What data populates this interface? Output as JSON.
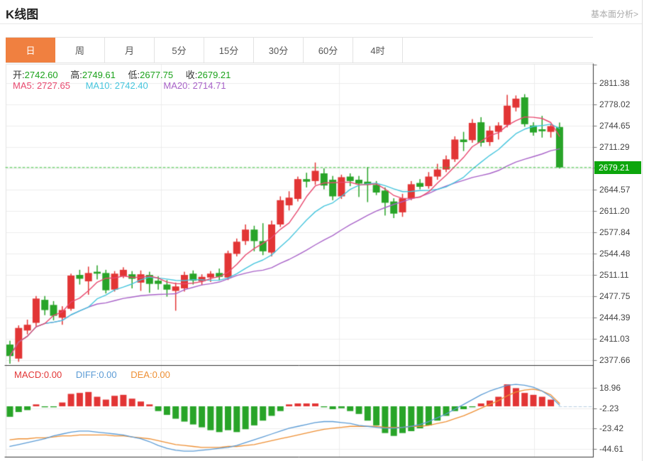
{
  "header": {
    "title": "K线图",
    "link_label": "基本面分析>"
  },
  "tabs": {
    "items": [
      {
        "label": "日",
        "active": true
      },
      {
        "label": "周",
        "active": false
      },
      {
        "label": "月",
        "active": false
      },
      {
        "label": "5分",
        "active": false
      },
      {
        "label": "15分",
        "active": false
      },
      {
        "label": "30分",
        "active": false
      },
      {
        "label": "60分",
        "active": false
      },
      {
        "label": "4时",
        "active": false
      }
    ]
  },
  "legend_ohlc": {
    "open_label": "开:",
    "open_value": "2742.60",
    "high_label": "高:",
    "high_value": "2749.61",
    "low_label": "低:",
    "low_value": "2677.75",
    "close_label": "收:",
    "close_value": "2679.21"
  },
  "legend_ma": {
    "ma5": "MA5: 2727.65",
    "ma10": "MA10: 2742.40",
    "ma20": "MA20: 2714.71"
  },
  "legend_macd": {
    "macd": "MACD:0.00",
    "diff": "DIFF:0.00",
    "dea": "DEA:0.00"
  },
  "colors": {
    "accent": "#f08040",
    "up": "#e23535",
    "down": "#28a428",
    "ohlc_value": "#1aa21a",
    "ma5": "#e8486e",
    "ma10": "#45c5dd",
    "ma20": "#a862c8",
    "diff": "#5b9bd5",
    "dea": "#ee8f33",
    "dotted_line": "#3bbd3b",
    "badge_bg": "#0ca60c",
    "grid": "#ececec",
    "border_light": "#e3e3e3",
    "border_dark": "#333333",
    "zero_dash": "#b8cfe0"
  },
  "chart_data": {
    "type": "candlestick",
    "title": "K线图",
    "legend": [
      "MA5",
      "MA10",
      "MA20",
      "MACD",
      "DIFF",
      "DEA"
    ],
    "price_axis": {
      "tick_labels": [
        "2811.38",
        "2778.02",
        "2744.65",
        "2711.29",
        "2644.57",
        "2611.20",
        "2577.84",
        "2544.48",
        "2511.11",
        "2477.75",
        "2444.39",
        "2411.03",
        "2377.66"
      ],
      "last_price": 2679.21,
      "last_price_label": "2679.21",
      "range": [
        2368.8,
        2841.4
      ],
      "grid": true
    },
    "last_candle": {
      "open": 2742.6,
      "high": 2749.61,
      "low": 2677.75,
      "close": 2679.21
    },
    "ma_values": {
      "ma5": 2727.65,
      "ma10": 2742.4,
      "ma20": 2714.71
    },
    "candles_ohlc": [
      [
        2402,
        2408,
        2372,
        2384
      ],
      [
        2380,
        2432,
        2375,
        2428
      ],
      [
        2424,
        2441,
        2418,
        2433
      ],
      [
        2436,
        2478,
        2430,
        2474
      ],
      [
        2472,
        2478,
        2448,
        2456
      ],
      [
        2464,
        2470,
        2440,
        2447
      ],
      [
        2444,
        2462,
        2433,
        2456
      ],
      [
        2458,
        2513,
        2455,
        2510
      ],
      [
        2511,
        2519,
        2496,
        2505
      ],
      [
        2501,
        2524,
        2480,
        2514
      ],
      [
        2516,
        2526,
        2504,
        2513
      ],
      [
        2514,
        2519,
        2482,
        2487
      ],
      [
        2488,
        2517,
        2485,
        2513
      ],
      [
        2509,
        2523,
        2506,
        2519
      ],
      [
        2512,
        2517,
        2490,
        2505
      ],
      [
        2499,
        2518,
        2486,
        2512
      ],
      [
        2511,
        2516,
        2483,
        2497
      ],
      [
        2502,
        2509,
        2488,
        2497
      ],
      [
        2496,
        2503,
        2477,
        2488
      ],
      [
        2486,
        2499,
        2455,
        2493
      ],
      [
        2490,
        2516,
        2485,
        2511
      ],
      [
        2513,
        2518,
        2496,
        2502
      ],
      [
        2501,
        2512,
        2495,
        2508
      ],
      [
        2507,
        2517,
        2500,
        2513
      ],
      [
        2514,
        2521,
        2502,
        2508
      ],
      [
        2507,
        2549,
        2503,
        2545
      ],
      [
        2544,
        2568,
        2540,
        2563
      ],
      [
        2564,
        2590,
        2558,
        2582
      ],
      [
        2582,
        2588,
        2548,
        2564
      ],
      [
        2564,
        2592,
        2542,
        2548
      ],
      [
        2546,
        2596,
        2540,
        2590
      ],
      [
        2590,
        2634,
        2586,
        2628
      ],
      [
        2620,
        2642,
        2612,
        2632
      ],
      [
        2630,
        2665,
        2626,
        2661
      ],
      [
        2661,
        2671,
        2648,
        2657
      ],
      [
        2658,
        2687,
        2652,
        2674
      ],
      [
        2670,
        2678,
        2645,
        2651
      ],
      [
        2660,
        2666,
        2628,
        2634
      ],
      [
        2634,
        2668,
        2630,
        2664
      ],
      [
        2665,
        2670,
        2650,
        2658
      ],
      [
        2660,
        2666,
        2633,
        2654
      ],
      [
        2657,
        2680,
        2625,
        2652
      ],
      [
        2652,
        2658,
        2636,
        2640
      ],
      [
        2643,
        2648,
        2604,
        2624
      ],
      [
        2626,
        2631,
        2600,
        2607
      ],
      [
        2609,
        2638,
        2602,
        2631
      ],
      [
        2631,
        2658,
        2628,
        2653
      ],
      [
        2655,
        2661,
        2645,
        2649
      ],
      [
        2650,
        2672,
        2646,
        2665
      ],
      [
        2665,
        2685,
        2660,
        2676
      ],
      [
        2676,
        2698,
        2672,
        2692
      ],
      [
        2692,
        2728,
        2688,
        2723
      ],
      [
        2723,
        2735,
        2705,
        2719
      ],
      [
        2722,
        2755,
        2718,
        2749
      ],
      [
        2750,
        2758,
        2712,
        2718
      ],
      [
        2719,
        2744,
        2713,
        2737
      ],
      [
        2735,
        2750,
        2723,
        2745
      ],
      [
        2746,
        2793,
        2742,
        2776
      ],
      [
        2773,
        2792,
        2767,
        2787
      ],
      [
        2789,
        2794,
        2743,
        2747
      ],
      [
        2745,
        2750,
        2729,
        2734
      ],
      [
        2739,
        2760,
        2726,
        2736
      ],
      [
        2735,
        2748,
        2726,
        2744
      ],
      [
        2742.6,
        2749.61,
        2677.75,
        2679.21
      ]
    ],
    "ma_periods": [
      5,
      10,
      20
    ],
    "macd_axis": {
      "tick_labels": [
        "18.96",
        "-2.23",
        "-23.42",
        "-44.61"
      ],
      "range": [
        -50.6,
        23.8
      ]
    },
    "macd": {
      "hist": [
        -11,
        -6,
        -4,
        2,
        -1,
        -1,
        4,
        13,
        14,
        15,
        10,
        7,
        11,
        12,
        8,
        5,
        2,
        -5,
        -9,
        -13,
        -16,
        -19,
        -22,
        -25,
        -27,
        -25,
        -27,
        -24,
        -20,
        -15,
        -10,
        -5,
        2,
        3,
        3,
        3,
        -1,
        -3,
        -2,
        -5,
        -8,
        -15,
        -20,
        -28,
        -31,
        -28,
        -26,
        -23,
        -20,
        -15,
        -10,
        -5,
        -3,
        -1,
        3,
        6,
        10,
        23,
        19,
        14,
        12,
        10,
        7,
        0
      ],
      "diff": [
        -42,
        -40,
        -38,
        -36,
        -34,
        -31,
        -29,
        -27,
        -26,
        -26,
        -27,
        -28,
        -29,
        -30,
        -32,
        -34,
        -37,
        -41,
        -44,
        -46,
        -47,
        -47,
        -46,
        -45,
        -44,
        -43,
        -41,
        -38,
        -35,
        -32,
        -29,
        -26,
        -23,
        -21,
        -19,
        -17,
        -16,
        -16,
        -17,
        -18,
        -20,
        -21,
        -22,
        -23,
        -23,
        -22,
        -21,
        -19,
        -16,
        -12,
        -8,
        -3,
        2,
        7,
        12,
        16,
        19,
        22,
        23,
        22,
        20,
        16,
        10,
        1
      ],
      "dea": [
        -35,
        -34,
        -34,
        -33,
        -33,
        -32,
        -31,
        -31,
        -30,
        -30,
        -30,
        -30,
        -31,
        -31,
        -32,
        -33,
        -34,
        -36,
        -38,
        -40,
        -41,
        -42,
        -43,
        -43,
        -43,
        -42,
        -42,
        -41,
        -40,
        -38,
        -36,
        -34,
        -32,
        -30,
        -28,
        -26,
        -24,
        -23,
        -22,
        -21,
        -21,
        -21,
        -21,
        -22,
        -22,
        -22,
        -21,
        -21,
        -20,
        -18,
        -16,
        -13,
        -10,
        -6,
        -2,
        2,
        6,
        11,
        15,
        17,
        18,
        16,
        12,
        3
      ]
    }
  }
}
